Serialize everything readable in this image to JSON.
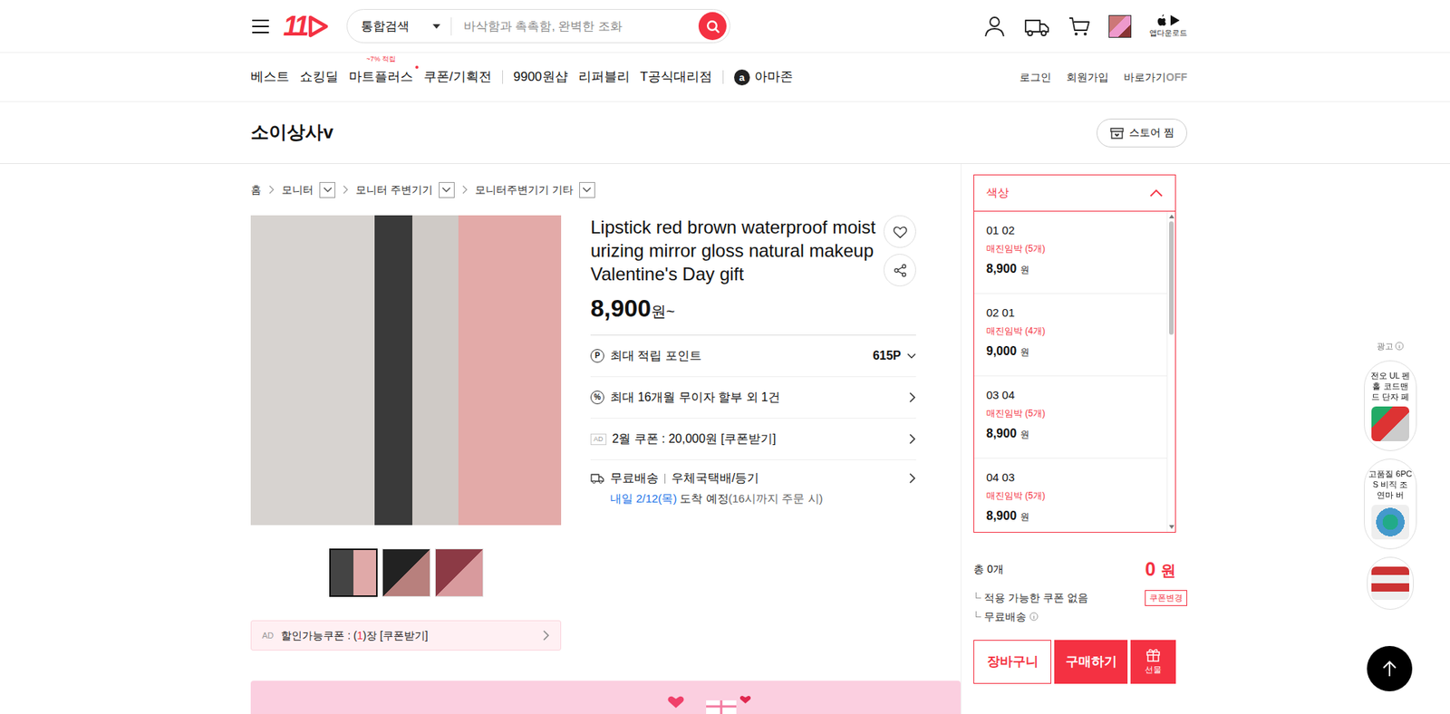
{
  "header": {
    "logo": "11",
    "search": {
      "scope": "통합검색",
      "placeholder": "바삭함과 촉촉함, 완벽한 조화"
    },
    "app_download": "앱다운로드"
  },
  "nav": {
    "groups": [
      [
        {
          "label": "베스트",
          "new": false
        },
        {
          "label": "쇼킹딜",
          "new": false
        },
        {
          "label": "마트플러스",
          "badge": "~7% 적립",
          "new": true
        },
        {
          "label": "쿠폰/기획전",
          "new": false
        }
      ],
      [
        {
          "label": "9900원샵",
          "new": false
        },
        {
          "label": "리퍼블리",
          "new": false
        },
        {
          "label": "T공식대리점",
          "new": false
        }
      ],
      [
        {
          "label": "아마존",
          "icon": "a",
          "new": false
        }
      ]
    ],
    "right": [
      {
        "label": "로그인"
      },
      {
        "label": "회원가입"
      }
    ],
    "shortcut": {
      "label": "바로가기",
      "toggle": "OFF",
      "on": false
    }
  },
  "store": {
    "name": "소이상사v",
    "follow": "스토어 찜"
  },
  "breadcrumb": [
    {
      "label": "홈",
      "has_menu": false
    },
    {
      "label": "모니터",
      "has_menu": true
    },
    {
      "label": "모니터 주변기기",
      "has_menu": true
    },
    {
      "label": "모니터주변기기 기타",
      "has_menu": true
    }
  ],
  "gallery": {
    "thumbnails": [
      {
        "selected": true
      },
      {
        "selected": false
      },
      {
        "selected": false
      }
    ]
  },
  "coupon_bar": {
    "ad": "AD",
    "before": "할인가능쿠폰 : (",
    "count": "1",
    "after": ")장 [쿠폰받기]"
  },
  "product": {
    "title": "Lipstick red brown waterproof moisturizing mirror gloss natural makeup Valentine's Day gift",
    "price": "8,900",
    "price_unit": "원~"
  },
  "benefits": [
    {
      "kind": "points",
      "icon": "P",
      "label": "최대 적립 포인트",
      "value": "615P"
    },
    {
      "kind": "installment",
      "icon": "%",
      "label": "최대 16개월 무이자 할부 외 1건"
    },
    {
      "kind": "coupon",
      "icon": "AD",
      "label": "2월 쿠폰 : 20,000원 [쿠폰받기]"
    },
    {
      "kind": "delivery",
      "label": "무료배송",
      "carrier": "우체국택배/등기",
      "eta_date": "내일 2/12(목)",
      "eta_text": "도착 예정",
      "eta_note": "(16시까지 주문 시)"
    }
  ],
  "options": {
    "title": "색상",
    "expanded": true,
    "items": [
      {
        "name": "01 02",
        "stock": "매진임박 (5개)",
        "price": "8,900",
        "unit": "원"
      },
      {
        "name": "02 01",
        "stock": "매진임박 (4개)",
        "price": "9,000",
        "unit": "원"
      },
      {
        "name": "03 04",
        "stock": "매진임박 (5개)",
        "price": "8,900",
        "unit": "원"
      },
      {
        "name": "04 03",
        "stock": "매진임박 (5개)",
        "price": "8,900",
        "unit": "원"
      }
    ]
  },
  "summary": {
    "total_label": "총 0개",
    "total_price": "0",
    "total_unit": "원",
    "coupon": "적용 가능한 쿠폰 없음",
    "coupon_button": "쿠폰변경",
    "shipping": "무료배송"
  },
  "buttons": {
    "cart": "장바구니",
    "buy": "구매하기",
    "gift": "선물"
  },
  "side_ads": {
    "label": "광고",
    "items": [
      {
        "text": "전오 UL 펜 홀 코드맨 드 단자 페"
      },
      {
        "text": "고품질 6PCS 비직 조 연마 버"
      },
      {
        "text": ""
      }
    ]
  }
}
